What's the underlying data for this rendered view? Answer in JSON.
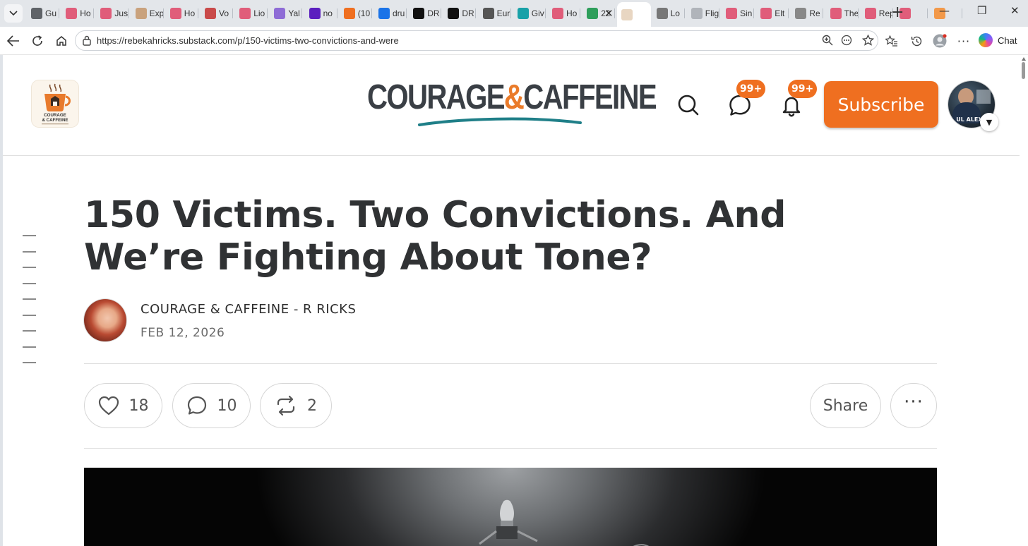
{
  "browser": {
    "tabs": [
      {
        "label": "Gu",
        "icon": "globe-icon",
        "color": "#5f6368"
      },
      {
        "label": "Ho",
        "icon": "youtube-icon",
        "color": "#e05d7a"
      },
      {
        "label": "Jus",
        "icon": "youtube-icon",
        "color": "#e05d7a"
      },
      {
        "label": "Exp",
        "icon": "spiral-icon",
        "color": "#c9a27d"
      },
      {
        "label": "Ho",
        "icon": "youtube-icon",
        "color": "#e05d7a"
      },
      {
        "label": "Vo",
        "icon": "document-icon",
        "color": "#c94a4a"
      },
      {
        "label": "Lio",
        "icon": "youtube-icon",
        "color": "#e05d7a"
      },
      {
        "label": "Yal",
        "icon": "slash-icon",
        "color": "#8e6cd6"
      },
      {
        "label": "no",
        "icon": "yahoo-icon",
        "color": "#5b1fbf"
      },
      {
        "label": "(10",
        "icon": "substack-icon",
        "color": "#ef6f20"
      },
      {
        "label": "dru",
        "icon": "search-icon",
        "color": "#1a73e8"
      },
      {
        "label": "DR",
        "icon": "dr-icon",
        "color": "#111111"
      },
      {
        "label": "DR",
        "icon": "dr-icon",
        "color": "#111111"
      },
      {
        "label": "Eur",
        "icon": "nyt-icon",
        "color": "#555555"
      },
      {
        "label": "Giv",
        "icon": "snowflake-icon",
        "color": "#19a1a8"
      },
      {
        "label": "Ho",
        "icon": "youtube-icon",
        "color": "#e05d7a"
      },
      {
        "label": "22",
        "icon": "chart-icon",
        "color": "#2e9e5b"
      },
      {
        "label": "",
        "icon": "substack-post-icon",
        "color": "#e8d6c2"
      },
      {
        "label": "Lo",
        "icon": "info-icon",
        "color": "#777777"
      },
      {
        "label": "Flig",
        "icon": "plane-icon",
        "color": "#b0b4ba"
      },
      {
        "label": "Sin",
        "icon": "youtube-icon",
        "color": "#e05d7a"
      },
      {
        "label": "Elt",
        "icon": "youtube-icon",
        "color": "#e05d7a"
      },
      {
        "label": "Re",
        "icon": "film-icon",
        "color": "#888888"
      },
      {
        "label": "The",
        "icon": "youtube-icon",
        "color": "#e05d7a"
      },
      {
        "label": "Rep",
        "icon": "youtube-icon",
        "color": "#e05d7a"
      },
      {
        "label": "",
        "icon": "youtube-icon",
        "color": "#e05d7a"
      },
      {
        "label": "",
        "icon": "bolt-icon",
        "color": "#f2994a"
      }
    ],
    "active_tab_index": 17,
    "url": "https://rebekahricks.substack.com/p/150-victims-two-convictions-and-were",
    "chat_label": "Chat"
  },
  "site": {
    "brand_left": "COURAGE",
    "brand_amp": "&",
    "brand_right": "CAFFEINE",
    "logo_text_line1": "COURAGE",
    "logo_text_line2": "& CAFFEINE",
    "chat_badge": "99+",
    "notifications_badge": "99+",
    "subscribe_label": "Subscribe",
    "user_avatar_caption": "UL ALEXA",
    "accent_color": "#ef6f20"
  },
  "post": {
    "title": "150 Victims. Two Convictions. And We’re Fighting About Tone?",
    "author": "COURAGE & CAFFEINE - R RICKS",
    "date": "FEB 12, 2026",
    "likes": "18",
    "comments": "10",
    "restacks": "2",
    "share_label": "Share"
  }
}
